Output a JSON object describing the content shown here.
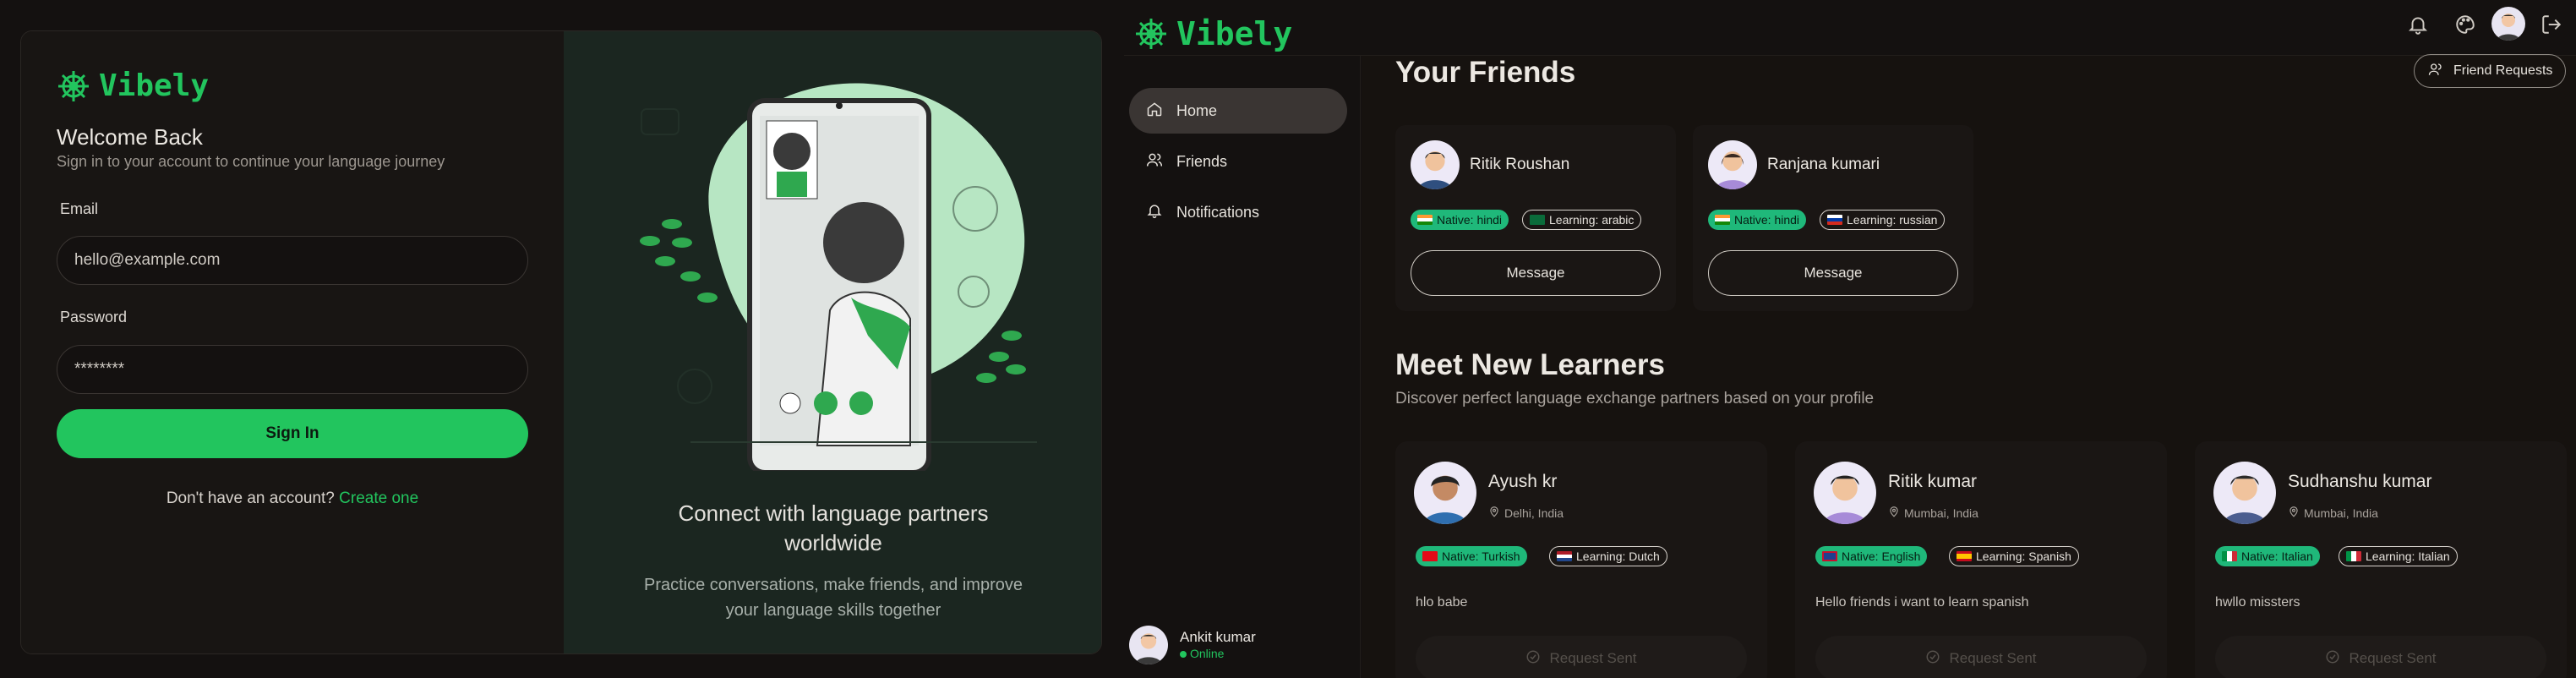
{
  "login": {
    "brand": "Vibely",
    "welcome_title": "Welcome Back",
    "welcome_sub": "Sign in to your account to continue your language journey",
    "email_label": "Email",
    "email_placeholder": "hello@example.com",
    "password_label": "Password",
    "password_placeholder": "********",
    "signin_label": "Sign In",
    "signup_prompt": "Don't have an account?",
    "signup_link": "Create one",
    "promo_title": "Connect with language partners worldwide",
    "promo_sub": "Practice conversations, make friends, and improve your language skills together"
  },
  "app": {
    "brand": "Vibely",
    "header": {
      "icons": [
        "bell-icon",
        "palette-icon",
        "avatar",
        "logout-icon"
      ]
    },
    "sidebar": {
      "items": [
        {
          "label": "Home",
          "icon": "home-icon",
          "active": true
        },
        {
          "label": "Friends",
          "icon": "users-icon",
          "active": false
        },
        {
          "label": "Notifications",
          "icon": "bell-icon",
          "active": false
        }
      ],
      "user": {
        "name": "Ankit kumar",
        "status": "Online"
      }
    },
    "friends": {
      "title": "Your Friends",
      "requests_button": "Friend Requests",
      "items": [
        {
          "name": "Ritik Roushan",
          "native": "Native: hindi",
          "learning": "Learning: arabic",
          "button": "Message"
        },
        {
          "name": "Ranjana kumari",
          "native": "Native: hindi",
          "learning": "Learning: russian",
          "button": "Message"
        }
      ]
    },
    "learners": {
      "title": "Meet New Learners",
      "subtitle": "Discover perfect language exchange partners based on your profile",
      "items": [
        {
          "name": "Ayush kr",
          "location": "Delhi, India",
          "native": "Native: Turkish",
          "learning": "Learning: Dutch",
          "bio": "hlo babe",
          "button": "Request Sent"
        },
        {
          "name": "Ritik kumar",
          "location": "Mumbai, India",
          "native": "Native: English",
          "learning": "Learning: Spanish",
          "bio": "Hello friends i want to learn spanish",
          "button": "Request Sent"
        },
        {
          "name": "Sudhanshu kumar",
          "location": "Mumbai, India",
          "native": "Native: Italian",
          "learning": "Learning: Italian",
          "bio": "hwllo missters",
          "button": "Request Sent"
        }
      ]
    },
    "colors": {
      "accent": "#22c55e",
      "native_badge": "#1fb87a",
      "active_nav": "#3a3533"
    }
  }
}
